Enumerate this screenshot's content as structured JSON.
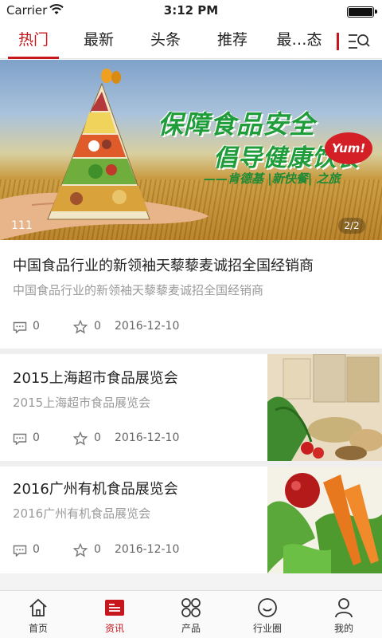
{
  "status_bar": {
    "carrier": "Carrier",
    "time": "3:12 PM"
  },
  "tabs": [
    {
      "label": "热门",
      "active": true
    },
    {
      "label": "最新",
      "active": false
    },
    {
      "label": "头条",
      "active": false
    },
    {
      "label": "推荐",
      "active": false
    },
    {
      "label": "最…态",
      "active": false
    }
  ],
  "tab_menu_icon": "list-search-icon",
  "banner": {
    "slogan_line1": "保障食品安全",
    "slogan_line2": "倡导健康饮食",
    "slogan_line3": "——肯德基 |新快餐| 之旅",
    "brand_badge": "Yum!",
    "caption": "111",
    "pager": "2/2"
  },
  "news": [
    {
      "title": "中国食品行业的新领袖天藜藜麦诚招全国经销商",
      "subtitle": "中国食品行业的新领袖天藜藜麦诚招全国经销商",
      "comments": "0",
      "favorites": "0",
      "date": "2016-12-10",
      "has_thumbnail": false
    },
    {
      "title": "2015上海超市食品展览会",
      "subtitle": "2015上海超市食品展览会",
      "comments": "0",
      "favorites": "0",
      "date": "2016-12-10",
      "has_thumbnail": true
    },
    {
      "title": "2016广州有机食品展览会",
      "subtitle": "2016广州有机食品展览会",
      "comments": "0",
      "favorites": "0",
      "date": "2016-12-10",
      "has_thumbnail": true
    }
  ],
  "bottom_nav": [
    {
      "label": "首页",
      "icon": "home-icon",
      "active": false
    },
    {
      "label": "资讯",
      "icon": "news-icon",
      "active": true
    },
    {
      "label": "产品",
      "icon": "products-grid-icon",
      "active": false
    },
    {
      "label": "行业圈",
      "icon": "industry-circle-icon",
      "active": false
    },
    {
      "label": "我的",
      "icon": "profile-icon",
      "active": false
    }
  ],
  "colors": {
    "accent": "#c8161d",
    "muted_text": "#9a9a9a",
    "separator": "#efefef"
  }
}
